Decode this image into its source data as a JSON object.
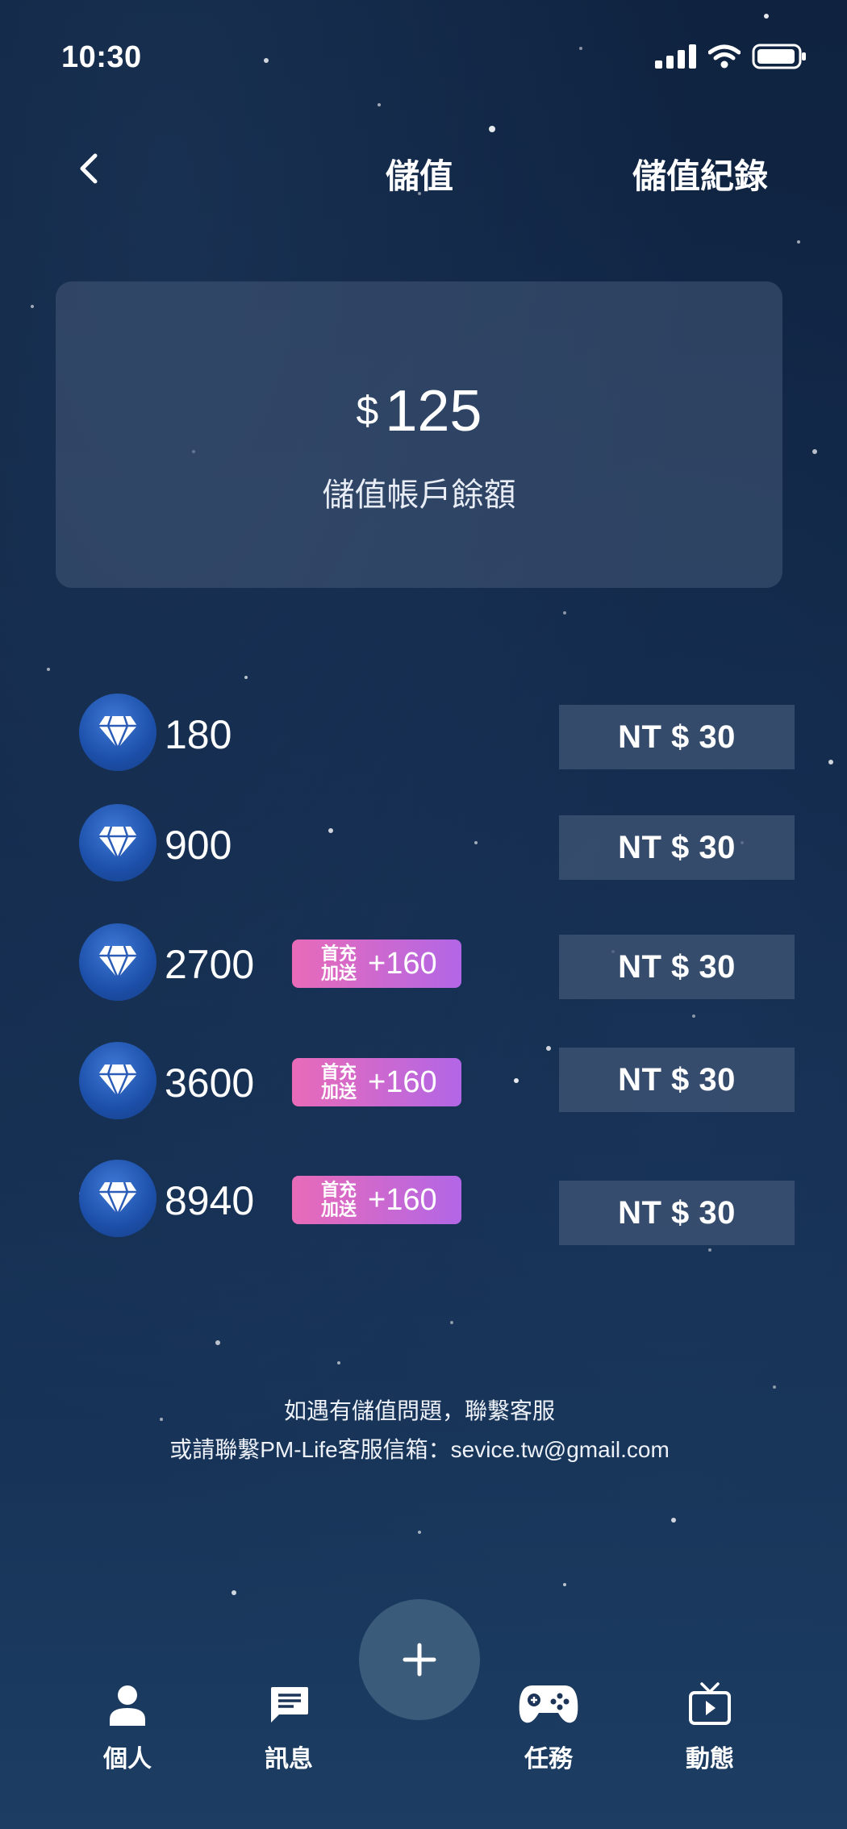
{
  "status_bar": {
    "time": "10:30"
  },
  "header": {
    "title": "儲值",
    "record_label": "儲值紀錄"
  },
  "balance": {
    "currency_symbol": "$",
    "amount": "125",
    "label": "儲值帳戶餘額"
  },
  "packages": [
    {
      "amount": "180",
      "price": "NT $ 30"
    },
    {
      "amount": "900",
      "price": "NT $ 30"
    },
    {
      "amount": "2700",
      "badge_line1": "首充",
      "badge_line2": "加送",
      "bonus": "+160",
      "price": "NT $ 30"
    },
    {
      "amount": "3600",
      "badge_line1": "首充",
      "badge_line2": "加送",
      "bonus": "+160",
      "price": "NT $ 30"
    },
    {
      "amount": "8940",
      "badge_line1": "首充",
      "badge_line2": "加送",
      "bonus": "+160",
      "price": "NT $ 30"
    }
  ],
  "footer": {
    "line1": "如遇有儲值問題，聯繫客服",
    "line2": "或請聯繫PM-Life客服信箱：sevice.tw@gmail.com"
  },
  "nav": {
    "items": [
      {
        "label": "個人",
        "icon": "person-icon"
      },
      {
        "label": "訊息",
        "icon": "message-icon"
      },
      {
        "label": "任務",
        "icon": "gamepad-icon"
      },
      {
        "label": "動態",
        "icon": "tv-icon"
      }
    ],
    "fab_icon": "plus-icon"
  },
  "colors": {
    "background": "#12294a",
    "card": "#3f5576",
    "badge_start": "#e86bb8",
    "badge_end": "#b266e6",
    "coin": "#1c4fa9"
  }
}
